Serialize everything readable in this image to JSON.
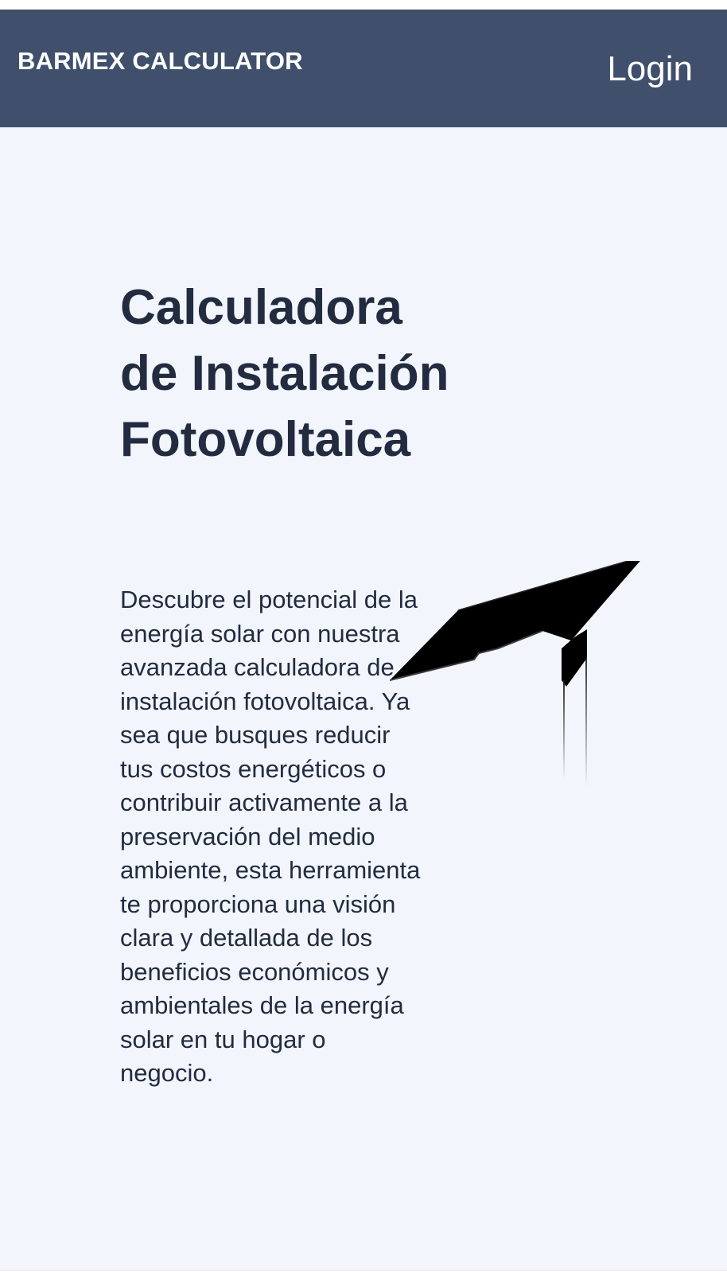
{
  "navbar": {
    "brand": "BARMEX CALCULATOR",
    "login_label": "Login",
    "background_color": "#3f4f6c"
  },
  "hero": {
    "title": "Calculadora de Instalación Fotovoltaica",
    "description": "Descubre el potencial de la energía solar con nuestra avanzada calculadora de instalación fotovoltaica. Ya sea que busques reducir tus costos energéticos o contribuir activamente a la preservación del medio ambiente, esta herramienta te proporciona una visión clara y detallada de los beneficios económicos y ambientales de la energía solar en tu hogar o negocio.",
    "illustration_icon": "solar-panel-icon",
    "text_color": "#232b40"
  },
  "page_background": "#f2f6fc"
}
